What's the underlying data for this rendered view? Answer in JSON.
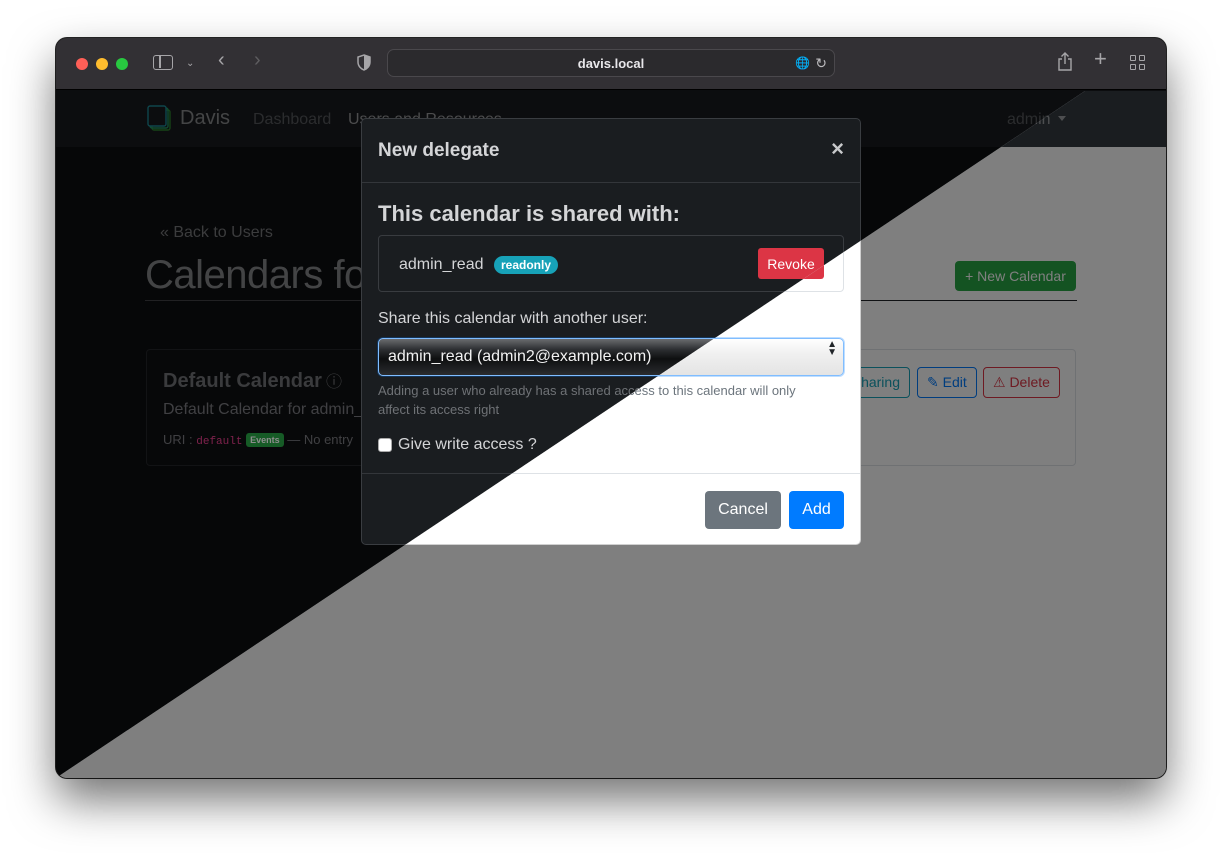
{
  "browser": {
    "url": "davis.local",
    "icons": [
      "sidebar-icon",
      "chevron-down-icon",
      "back-icon",
      "forward-icon",
      "shield-icon",
      "translate-icon",
      "reload-icon",
      "share-icon",
      "new-tab-icon",
      "tab-overview-icon"
    ]
  },
  "navbar": {
    "brand": "Davis",
    "links": [
      {
        "label": "Dashboard"
      },
      {
        "label": "Users and Resources"
      }
    ],
    "user_menu": "admin"
  },
  "page": {
    "back_link": "« Back to Users",
    "title": "Calendars for admin_read",
    "new_calendar_button": "+ New Calendar",
    "calendars": [
      {
        "name": "Default Calendar",
        "info_icon": "ⓘ",
        "description": "Default Calendar for admin_read",
        "uri_label": "URI :",
        "uri": "default",
        "type_badge": "Events",
        "entries": "— No entry",
        "actions": {
          "sharing": "☰ Sharing",
          "edit": "✎ Edit",
          "delete": "⚠ Delete"
        }
      }
    ]
  },
  "modal": {
    "title": "New delegate",
    "close": "×",
    "shared_heading": "This calendar is shared with:",
    "shared_with": [
      {
        "user": "admin_read",
        "access_badge": "readonly",
        "revoke_label": "Revoke"
      }
    ],
    "share_label": "Share this calendar with another user:",
    "user_select_value": "admin_read (admin2@example.com)",
    "help_text": "Adding a user who already has a shared access to this calendar will only affect its access right",
    "write_access_label": "Give write access ?",
    "write_access_checked": false,
    "cancel_label": "Cancel",
    "add_label": "Add"
  },
  "colors": {
    "primary": "#007bff",
    "success": "#28a745",
    "danger": "#dc3545",
    "info": "#17a2b8",
    "secondary": "#6c757d"
  }
}
